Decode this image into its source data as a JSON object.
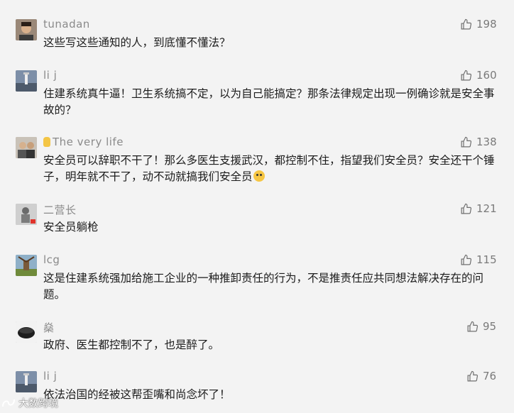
{
  "comments": [
    {
      "user": "tunadan",
      "text": "这些写这些通知的人，到底懂不懂法？",
      "likes": "198",
      "avatar_color": "#6b5a4a"
    },
    {
      "user": "li j",
      "text": "住建系统真牛逼！卫生系统搞不定，以为自己能搞定？那条法律规定出现一例确诊就是安全事故的？",
      "likes": "160",
      "avatar_color": "#5a6a8a"
    },
    {
      "user": "The very life",
      "text": "安全员可以辞职不干了！那么多医生支援武汉，都控制不住，指望我们安全员？安全还干个锤子，明年就不干了，动不动就搞我们安全员",
      "likes": "138",
      "avatar_color": "#8a7a70"
    },
    {
      "user": "二营长",
      "text": "安全员躺枪",
      "likes": "121",
      "avatar_color": "#7a8a7a"
    },
    {
      "user": "lcg",
      "text": "这是住建系统强加给施工企业的一种推卸责任的行为，不是推责任应共同想法解决存在的问题。",
      "likes": "115",
      "avatar_color": "#6a8aa0"
    },
    {
      "user": "燊",
      "text": "政府、医生都控制不了，也是醉了。",
      "likes": "95",
      "avatar_color": "#2a2a2a"
    },
    {
      "user": "li j",
      "text": "依法治国的经被这帮歪嘴和尚念坏了！",
      "likes": "76",
      "avatar_color": "#5a6a8a"
    }
  ],
  "icons": {
    "like": "thumbs-up-icon",
    "emoji": "crying-face-icon",
    "hand": "waving-hand-icon"
  },
  "watermark": "大数跨境",
  "colors": {
    "background": "#f3f3f3",
    "username": "#8a8a8a",
    "text": "#1b1b1b",
    "likes": "#7a7a7a"
  }
}
